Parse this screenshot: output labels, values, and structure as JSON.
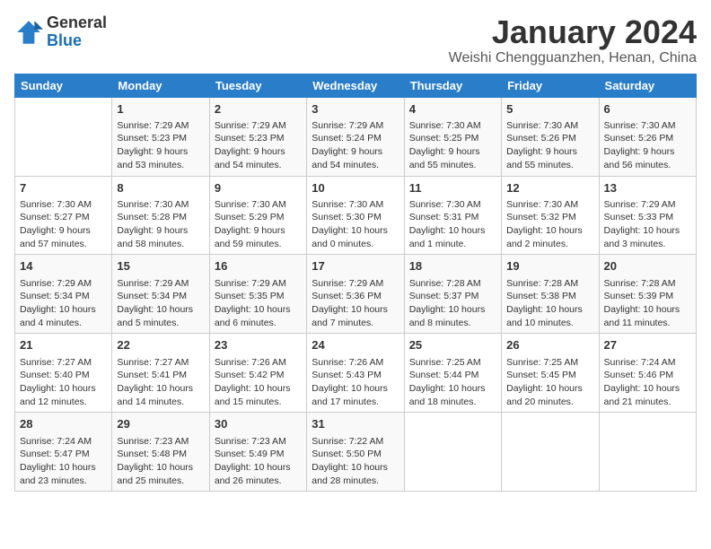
{
  "logo": {
    "general": "General",
    "blue": "Blue"
  },
  "title": "January 2024",
  "subtitle": "Weishi Chengguanzhen, Henan, China",
  "days_of_week": [
    "Sunday",
    "Monday",
    "Tuesday",
    "Wednesday",
    "Thursday",
    "Friday",
    "Saturday"
  ],
  "weeks": [
    [
      {
        "num": "",
        "sunrise": "",
        "sunset": "",
        "daylight": ""
      },
      {
        "num": "1",
        "sunrise": "Sunrise: 7:29 AM",
        "sunset": "Sunset: 5:23 PM",
        "daylight": "Daylight: 9 hours and 53 minutes."
      },
      {
        "num": "2",
        "sunrise": "Sunrise: 7:29 AM",
        "sunset": "Sunset: 5:23 PM",
        "daylight": "Daylight: 9 hours and 54 minutes."
      },
      {
        "num": "3",
        "sunrise": "Sunrise: 7:29 AM",
        "sunset": "Sunset: 5:24 PM",
        "daylight": "Daylight: 9 hours and 54 minutes."
      },
      {
        "num": "4",
        "sunrise": "Sunrise: 7:30 AM",
        "sunset": "Sunset: 5:25 PM",
        "daylight": "Daylight: 9 hours and 55 minutes."
      },
      {
        "num": "5",
        "sunrise": "Sunrise: 7:30 AM",
        "sunset": "Sunset: 5:26 PM",
        "daylight": "Daylight: 9 hours and 55 minutes."
      },
      {
        "num": "6",
        "sunrise": "Sunrise: 7:30 AM",
        "sunset": "Sunset: 5:26 PM",
        "daylight": "Daylight: 9 hours and 56 minutes."
      }
    ],
    [
      {
        "num": "7",
        "sunrise": "Sunrise: 7:30 AM",
        "sunset": "Sunset: 5:27 PM",
        "daylight": "Daylight: 9 hours and 57 minutes."
      },
      {
        "num": "8",
        "sunrise": "Sunrise: 7:30 AM",
        "sunset": "Sunset: 5:28 PM",
        "daylight": "Daylight: 9 hours and 58 minutes."
      },
      {
        "num": "9",
        "sunrise": "Sunrise: 7:30 AM",
        "sunset": "Sunset: 5:29 PM",
        "daylight": "Daylight: 9 hours and 59 minutes."
      },
      {
        "num": "10",
        "sunrise": "Sunrise: 7:30 AM",
        "sunset": "Sunset: 5:30 PM",
        "daylight": "Daylight: 10 hours and 0 minutes."
      },
      {
        "num": "11",
        "sunrise": "Sunrise: 7:30 AM",
        "sunset": "Sunset: 5:31 PM",
        "daylight": "Daylight: 10 hours and 1 minute."
      },
      {
        "num": "12",
        "sunrise": "Sunrise: 7:30 AM",
        "sunset": "Sunset: 5:32 PM",
        "daylight": "Daylight: 10 hours and 2 minutes."
      },
      {
        "num": "13",
        "sunrise": "Sunrise: 7:29 AM",
        "sunset": "Sunset: 5:33 PM",
        "daylight": "Daylight: 10 hours and 3 minutes."
      }
    ],
    [
      {
        "num": "14",
        "sunrise": "Sunrise: 7:29 AM",
        "sunset": "Sunset: 5:34 PM",
        "daylight": "Daylight: 10 hours and 4 minutes."
      },
      {
        "num": "15",
        "sunrise": "Sunrise: 7:29 AM",
        "sunset": "Sunset: 5:34 PM",
        "daylight": "Daylight: 10 hours and 5 minutes."
      },
      {
        "num": "16",
        "sunrise": "Sunrise: 7:29 AM",
        "sunset": "Sunset: 5:35 PM",
        "daylight": "Daylight: 10 hours and 6 minutes."
      },
      {
        "num": "17",
        "sunrise": "Sunrise: 7:29 AM",
        "sunset": "Sunset: 5:36 PM",
        "daylight": "Daylight: 10 hours and 7 minutes."
      },
      {
        "num": "18",
        "sunrise": "Sunrise: 7:28 AM",
        "sunset": "Sunset: 5:37 PM",
        "daylight": "Daylight: 10 hours and 8 minutes."
      },
      {
        "num": "19",
        "sunrise": "Sunrise: 7:28 AM",
        "sunset": "Sunset: 5:38 PM",
        "daylight": "Daylight: 10 hours and 10 minutes."
      },
      {
        "num": "20",
        "sunrise": "Sunrise: 7:28 AM",
        "sunset": "Sunset: 5:39 PM",
        "daylight": "Daylight: 10 hours and 11 minutes."
      }
    ],
    [
      {
        "num": "21",
        "sunrise": "Sunrise: 7:27 AM",
        "sunset": "Sunset: 5:40 PM",
        "daylight": "Daylight: 10 hours and 12 minutes."
      },
      {
        "num": "22",
        "sunrise": "Sunrise: 7:27 AM",
        "sunset": "Sunset: 5:41 PM",
        "daylight": "Daylight: 10 hours and 14 minutes."
      },
      {
        "num": "23",
        "sunrise": "Sunrise: 7:26 AM",
        "sunset": "Sunset: 5:42 PM",
        "daylight": "Daylight: 10 hours and 15 minutes."
      },
      {
        "num": "24",
        "sunrise": "Sunrise: 7:26 AM",
        "sunset": "Sunset: 5:43 PM",
        "daylight": "Daylight: 10 hours and 17 minutes."
      },
      {
        "num": "25",
        "sunrise": "Sunrise: 7:25 AM",
        "sunset": "Sunset: 5:44 PM",
        "daylight": "Daylight: 10 hours and 18 minutes."
      },
      {
        "num": "26",
        "sunrise": "Sunrise: 7:25 AM",
        "sunset": "Sunset: 5:45 PM",
        "daylight": "Daylight: 10 hours and 20 minutes."
      },
      {
        "num": "27",
        "sunrise": "Sunrise: 7:24 AM",
        "sunset": "Sunset: 5:46 PM",
        "daylight": "Daylight: 10 hours and 21 minutes."
      }
    ],
    [
      {
        "num": "28",
        "sunrise": "Sunrise: 7:24 AM",
        "sunset": "Sunset: 5:47 PM",
        "daylight": "Daylight: 10 hours and 23 minutes."
      },
      {
        "num": "29",
        "sunrise": "Sunrise: 7:23 AM",
        "sunset": "Sunset: 5:48 PM",
        "daylight": "Daylight: 10 hours and 25 minutes."
      },
      {
        "num": "30",
        "sunrise": "Sunrise: 7:23 AM",
        "sunset": "Sunset: 5:49 PM",
        "daylight": "Daylight: 10 hours and 26 minutes."
      },
      {
        "num": "31",
        "sunrise": "Sunrise: 7:22 AM",
        "sunset": "Sunset: 5:50 PM",
        "daylight": "Daylight: 10 hours and 28 minutes."
      },
      {
        "num": "",
        "sunrise": "",
        "sunset": "",
        "daylight": ""
      },
      {
        "num": "",
        "sunrise": "",
        "sunset": "",
        "daylight": ""
      },
      {
        "num": "",
        "sunrise": "",
        "sunset": "",
        "daylight": ""
      }
    ]
  ]
}
